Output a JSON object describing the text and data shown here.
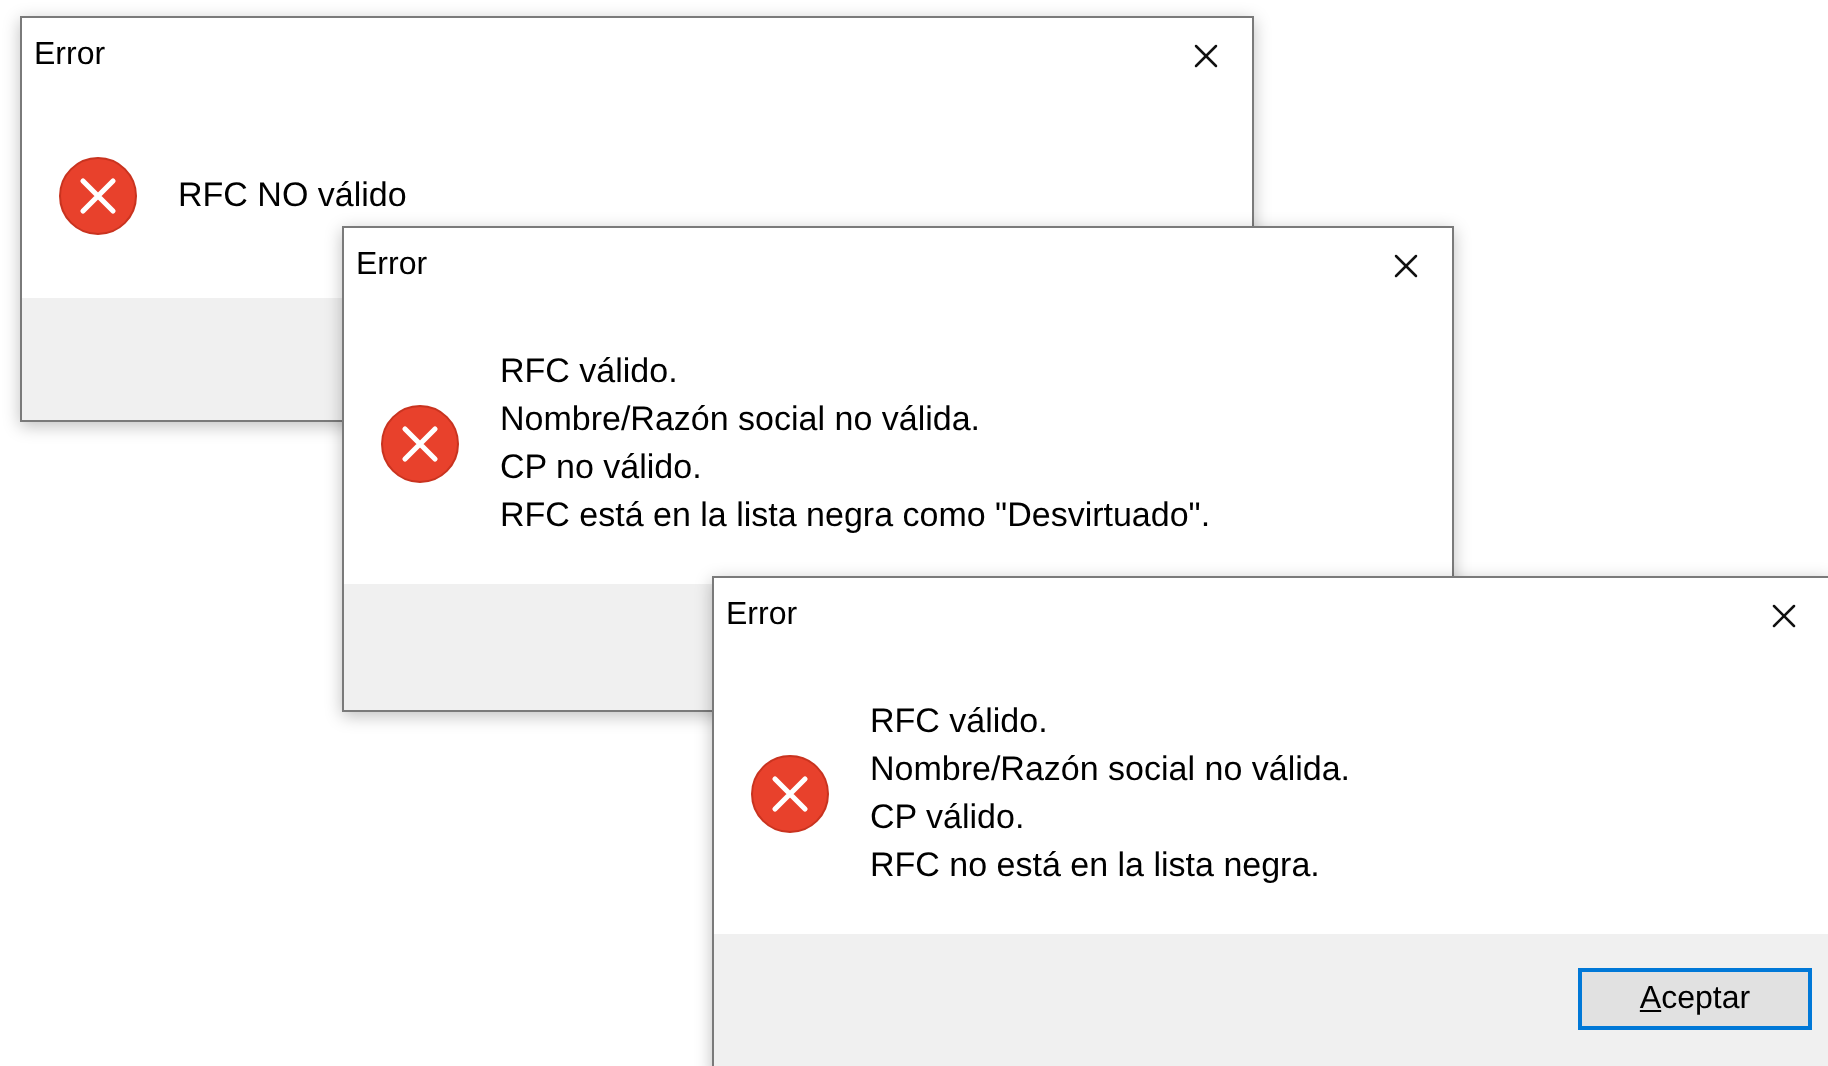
{
  "windows": [
    {
      "title": "Error",
      "messages": [
        "RFC NO válido"
      ]
    },
    {
      "title": "Error",
      "messages": [
        "RFC válido.",
        "Nombre/Razón social no válida.",
        "CP no válido.",
        "RFC está en la lista negra como \"Desvirtuado\"."
      ]
    },
    {
      "title": "Error",
      "messages": [
        "RFC válido.",
        "Nombre/Razón social no válida.",
        "CP válido.",
        "RFC no está en la lista negra."
      ],
      "buttons": [
        {
          "label": "Aceptar",
          "focused": true,
          "underline_first_letter": true
        }
      ]
    }
  ]
}
